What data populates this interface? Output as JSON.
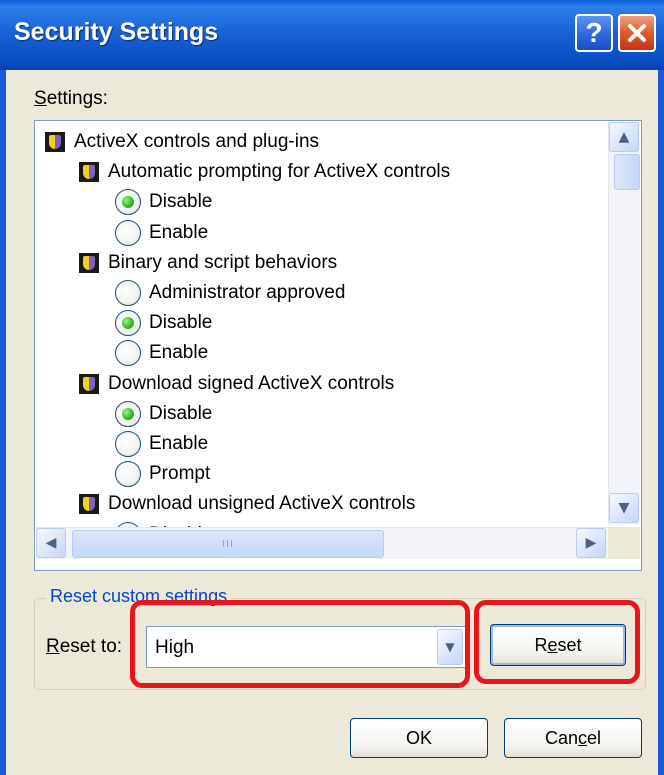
{
  "window": {
    "title": "Security Settings",
    "help_glyph": "?",
    "close_icon": "close-icon",
    "help_icon": "help-icon"
  },
  "settings_label": {
    "accel": "S",
    "rest": "ettings:"
  },
  "tree": [
    {
      "type": "category",
      "label": "ActiveX controls and plug-ins",
      "icon": "shield-icon",
      "level": 0
    },
    {
      "type": "setting",
      "label": "Automatic prompting for ActiveX controls",
      "icon": "shield-icon",
      "level": 1
    },
    {
      "type": "option",
      "label": "Disable",
      "checked": true,
      "level": 2
    },
    {
      "type": "option",
      "label": "Enable",
      "checked": false,
      "level": 2
    },
    {
      "type": "setting",
      "label": "Binary and script behaviors",
      "icon": "shield-icon",
      "level": 1
    },
    {
      "type": "option",
      "label": "Administrator approved",
      "checked": false,
      "level": 2
    },
    {
      "type": "option",
      "label": "Disable",
      "checked": true,
      "level": 2
    },
    {
      "type": "option",
      "label": "Enable",
      "checked": false,
      "level": 2
    },
    {
      "type": "setting",
      "label": "Download signed ActiveX controls",
      "icon": "shield-icon",
      "level": 1
    },
    {
      "type": "option",
      "label": "Disable",
      "checked": true,
      "level": 2
    },
    {
      "type": "option",
      "label": "Enable",
      "checked": false,
      "level": 2
    },
    {
      "type": "option",
      "label": "Prompt",
      "checked": false,
      "level": 2
    },
    {
      "type": "setting",
      "label": "Download unsigned ActiveX controls",
      "icon": "shield-icon",
      "level": 1
    },
    {
      "type": "option",
      "label": "Disable",
      "checked": true,
      "level": 2
    }
  ],
  "scrollbar": {
    "grip_glyph": "III"
  },
  "reset_group": {
    "legend": "Reset custom settings",
    "reset_to_label": {
      "accel": "R",
      "rest": "eset to:"
    },
    "selected_value": "High",
    "reset_button": {
      "pre": "R",
      "accel": "e",
      "post": "set"
    }
  },
  "buttons": {
    "ok": "OK",
    "cancel": {
      "pre": "Can",
      "accel": "c",
      "post": "el"
    }
  },
  "annotation_color": "#e8151c"
}
